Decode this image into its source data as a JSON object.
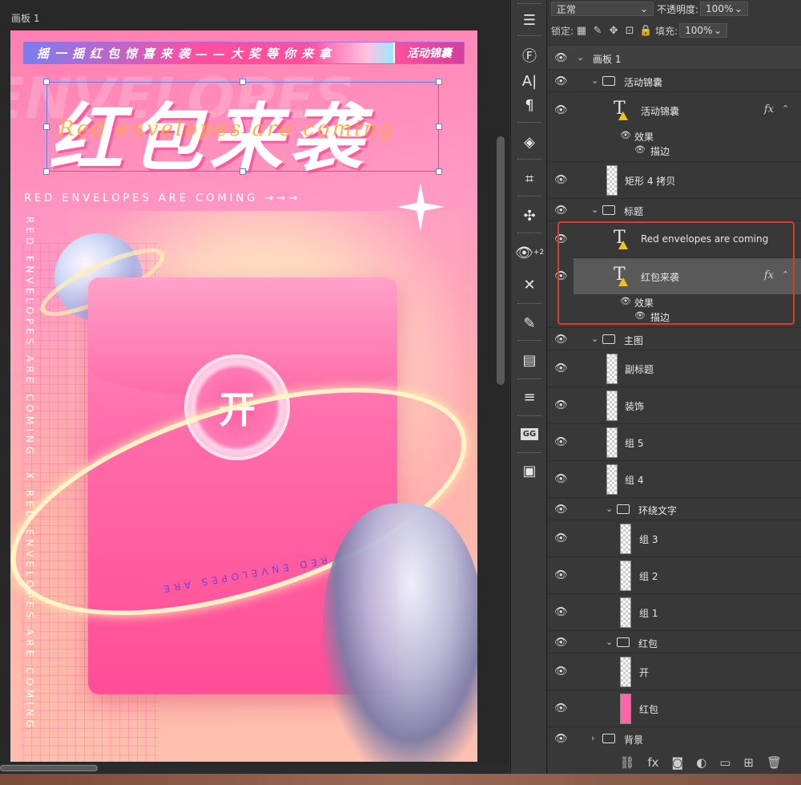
{
  "canvas": {
    "artboard_label": "画板 1",
    "banner_text": "摇一摇红包惊喜来袭——大奖等你来拿",
    "banner_tag": "活动锦囊",
    "title": "红包来袭",
    "title_script": "Red envelopes are coming",
    "bg_words": "ENVELOPES",
    "subtitle": "RED ENVELOPES ARE COMING →→→",
    "vertical_text": "RED ENVELOPES ARE COMING. X RED ENVELOPES ARE COMING.",
    "open_label": "开",
    "orbit_text": "RED ENVELOPES ARE"
  },
  "toolbar": {
    "blend_mode": "正常",
    "opacity_label": "不透明度:",
    "opacity_value": "100%",
    "lock_label": "锁定:",
    "fill_label": "填充:",
    "fill_value": "100%"
  },
  "tools": [
    "sliders-icon",
    "font-icon",
    "character-icon",
    "paragraph-icon",
    "3d-icon",
    "crop-icon",
    "puzzle-icon",
    "eye-plus-icon",
    "eye-cross-icon",
    "brush-icon",
    "layers-icon",
    "adjust-icon",
    "gg-icon",
    "square-icon"
  ],
  "tool_text": {
    "eye_plus": "+2",
    "gg": "GG"
  },
  "layers": {
    "artboard": "画板 1",
    "group_activity": "活动锦囊",
    "text_activity": "活动锦囊",
    "effects": "效果",
    "stroke": "描边",
    "rect_copy": "矩形 4 拷贝",
    "group_title": "标题",
    "text_english": "Red envelopes are coming",
    "text_title": "红包来袭",
    "effects2": "效果",
    "stroke2": "描边",
    "group_main": "主图",
    "subtitle_layer": "副标题",
    "decoration": "装饰",
    "group5": "组 5",
    "group4": "组 4",
    "group_surround": "环绕文字",
    "group3": "组 3",
    "group2": "组 2",
    "group1": "组 1",
    "group_envelope": "红包",
    "open_layer": "开",
    "envelope_layer": "红包",
    "background": "背景"
  },
  "fx_label": "fx"
}
